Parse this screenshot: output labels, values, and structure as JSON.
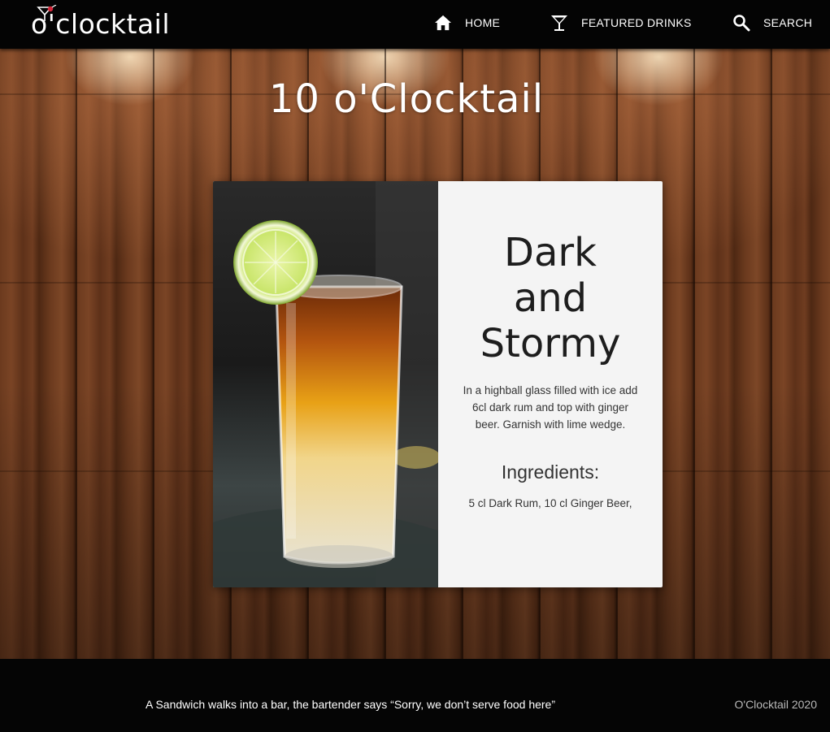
{
  "navbar": {
    "logo_text": "o'clocktail",
    "items": [
      {
        "label": "HOME",
        "icon": "home-icon"
      },
      {
        "label": "FEATURED DRINKS",
        "icon": "cocktail-glass-icon"
      },
      {
        "label": "SEARCH",
        "icon": "search-icon"
      }
    ]
  },
  "page": {
    "title": "10 o'Clocktail"
  },
  "drink": {
    "name_lines": [
      "Dark",
      "and",
      "Stormy"
    ],
    "instructions": "In a highball glass filled with ice add 6cl dark rum and top with ginger beer. Garnish with lime wedge.",
    "ingredients_heading": "Ingredients:",
    "ingredients": "5 cl Dark Rum, 10 cl Ginger Beer,"
  },
  "footer": {
    "joke": "A Sandwich walks into a bar, the bartender says “Sorry, we don’t serve food here”",
    "copyright": "O'Clocktail 2020"
  },
  "colors": {
    "navbar_bg": "#040404",
    "card_bg": "#f4f4f4",
    "footer_bg": "#050505",
    "wood": "#6b3a1e"
  }
}
